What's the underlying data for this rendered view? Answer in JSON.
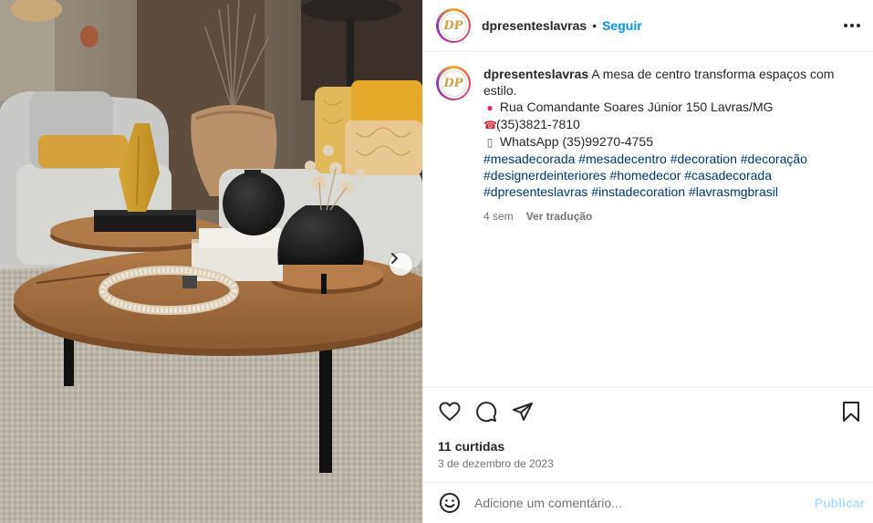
{
  "post": {
    "username": "dpresenteslavras",
    "avatar_initials": "DP",
    "follow_label": "Seguir",
    "separator": "•",
    "caption_text": "A mesa de centro transforma espaços com",
    "caption_text_2": "estilo.",
    "address": "Rua Comandante Soares Júnior 150 Lavras/MG",
    "phone": "(35)3821-7810",
    "whatsapp": "WhatsApp (35)99270-4755",
    "hashtags": {
      "h1": "#mesadecorada",
      "h2": "#mesadecentro",
      "h3": "#decoration",
      "h4": "#decoração",
      "h5": "#designerdeinteriores",
      "h6": "#homedecor",
      "h7": "#casadecorada",
      "h8": "#dpresenteslavras",
      "h9": "#instadecoration",
      "h10": "#lavrasmgbrasil"
    },
    "time_ago": "4 sem",
    "translate_label": "Ver tradução",
    "likes": "11 curtidas",
    "date": "3 de dezembro de 2023"
  },
  "icons": {
    "pin": "round-pushpin-icon",
    "phone": "telephone-icon",
    "mobile": "mobile-phone-icon",
    "like": "heart-icon",
    "comment": "speech-bubble-icon",
    "share": "paper-plane-icon",
    "save": "bookmark-icon",
    "more": "more-horizontal-icon",
    "next": "chevron-right-icon",
    "emoji": "smiley-icon"
  },
  "comment": {
    "placeholder": "Adicione um comentário...",
    "publish_label": "Publicar"
  },
  "colors": {
    "link_blue": "#0095f6",
    "hashtag": "#00376b",
    "publish_disabled": "#b3dbff",
    "muted": "#737373"
  }
}
